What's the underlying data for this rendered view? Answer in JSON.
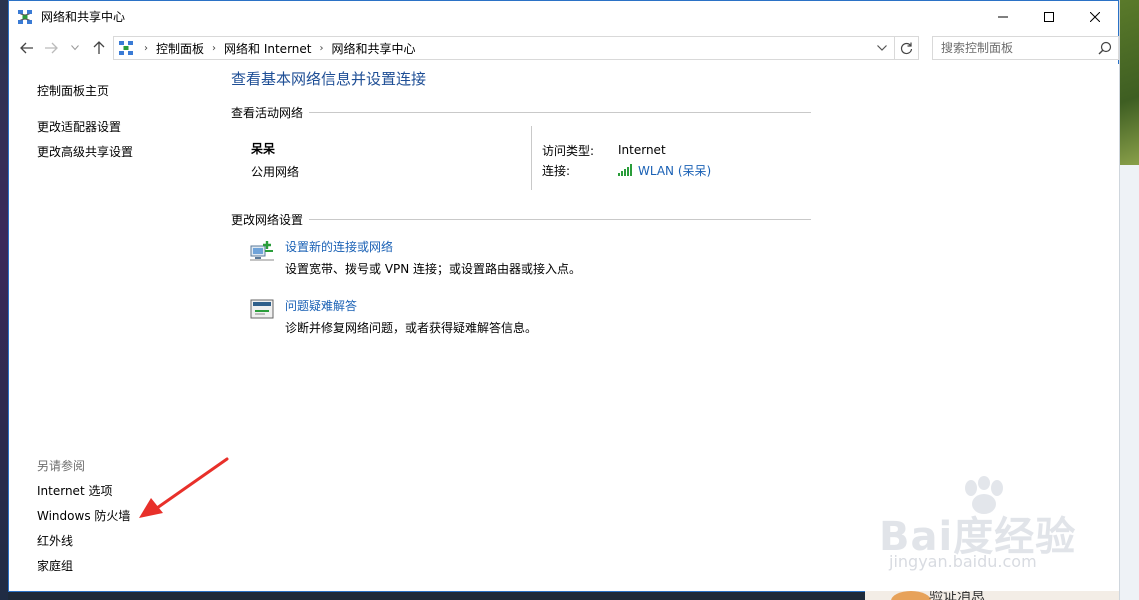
{
  "window": {
    "title": "网络和共享中心"
  },
  "addressbar": {
    "breadcrumbs": [
      "控制面板",
      "网络和 Internet",
      "网络和共享中心"
    ],
    "search_placeholder": "搜索控制面板"
  },
  "sidebar": {
    "home": "控制面板主页",
    "links": [
      "更改适配器设置",
      "更改高级共享设置"
    ],
    "see_also_heading": "另请参阅",
    "see_also": [
      "Internet 选项",
      "Windows 防火墙",
      "红外线",
      "家庭组"
    ]
  },
  "main": {
    "title": "查看基本网络信息并设置连接",
    "active_section": "查看活动网络",
    "network": {
      "name": "呆呆",
      "type": "公用网络",
      "access_label": "访问类型:",
      "access_value": "Internet",
      "connection_label": "连接:",
      "connection_value": "WLAN (呆呆)"
    },
    "change_section": "更改网络设置",
    "tasks": [
      {
        "link": "设置新的连接或网络",
        "desc": "设置宽带、拨号或 VPN 连接；或设置路由器或接入点。",
        "icon": "new-connection-icon"
      },
      {
        "link": "问题疑难解答",
        "desc": "诊断并修复网络问题，或者获得疑难解答信息。",
        "icon": "troubleshoot-icon"
      }
    ]
  },
  "watermark": {
    "logo": "Bai度经验",
    "url": "jingyan.baidu.com"
  },
  "notification": {
    "text": "验证消息"
  },
  "colors": {
    "link": "#1a61b5",
    "title": "#1e4e95",
    "window_border": "#2b72c6",
    "annotation_arrow": "#e8302a"
  }
}
